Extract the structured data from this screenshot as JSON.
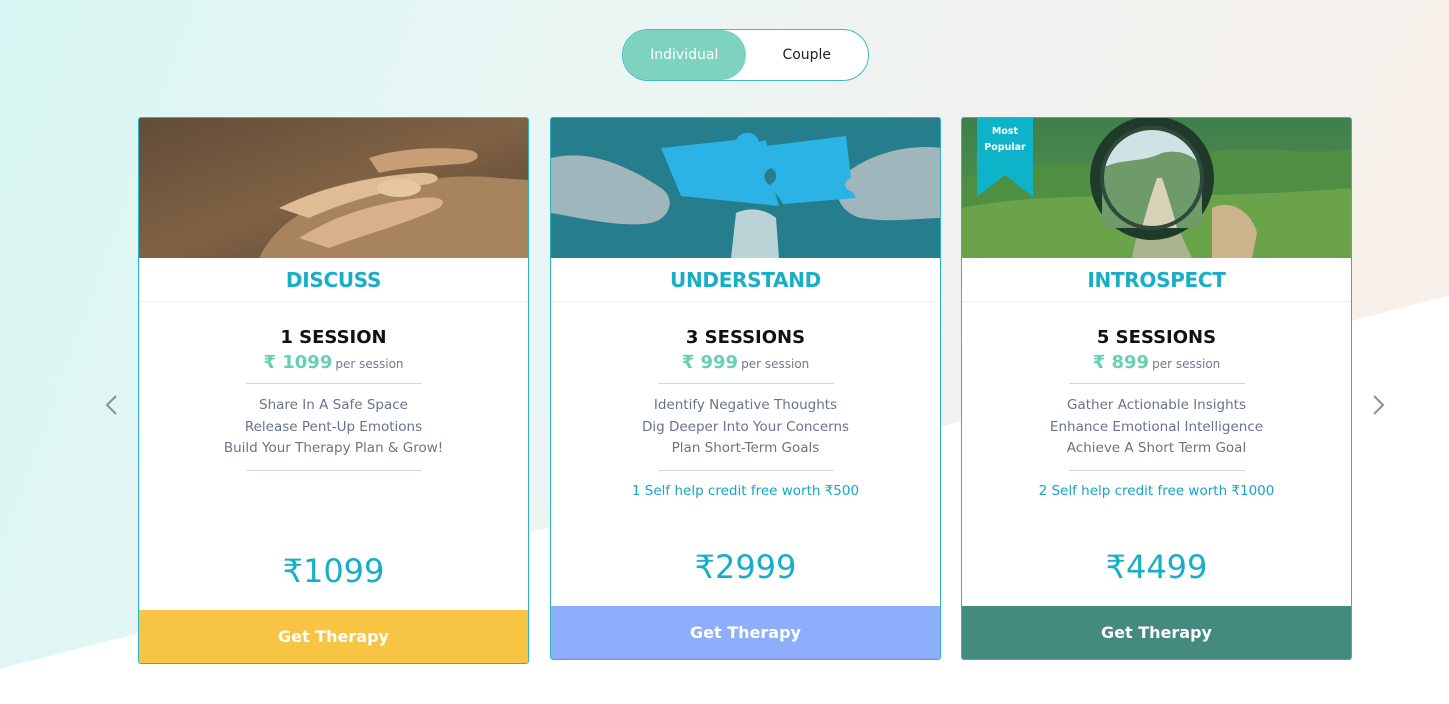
{
  "toggle": {
    "options": [
      {
        "label": "Individual",
        "active": true
      },
      {
        "label": "Couple",
        "active": false
      }
    ]
  },
  "nav": {
    "prev_icon": "chevron-left-icon",
    "next_icon": "chevron-right-icon"
  },
  "currency_symbol": "₹",
  "plans": [
    {
      "title": "DISCUSS",
      "sessions": "1 SESSION",
      "per_session_price": "₹ 1099",
      "per_session_label": "per session",
      "features": [
        "Share In A Safe Space",
        "Release Pent-Up Emotions",
        "Build Your Therapy Plan & Grow!"
      ],
      "credit": "",
      "total": "₹1099",
      "cta": "Get Therapy",
      "cta_color": "#f8c443",
      "image": "holding-hands"
    },
    {
      "title": "UNDERSTAND",
      "sessions": "3 SESSIONS",
      "per_session_price": "₹ 999",
      "per_session_label": "per session",
      "features": [
        "Identify Negative Thoughts",
        "Dig Deeper Into Your Concerns",
        "Plan Short-Term Goals"
      ],
      "credit": "1 Self help credit free worth ₹500",
      "total": "₹2999",
      "cta": "Get Therapy",
      "cta_color": "#8eaefc",
      "image": "puzzle-pieces"
    },
    {
      "title": "INTROSPECT",
      "sessions": "5 SESSIONS",
      "per_session_price": "₹ 899",
      "per_session_label": "per session",
      "features": [
        "Gather Actionable Insights",
        "Enhance Emotional Intelligence",
        "Achieve A Short Term Goal"
      ],
      "credit": "2 Self help credit free worth ₹1000",
      "total": "₹4499",
      "cta": "Get Therapy",
      "cta_color": "#448a7e",
      "image": "lens-landscape",
      "badge": {
        "line1": "Most",
        "line2": "Popular",
        "color": "#0eb3c9"
      }
    }
  ],
  "colors": {
    "accent": "#17aec8",
    "price_green": "#67d0b2",
    "toggle_active": "#7dd3bf"
  }
}
